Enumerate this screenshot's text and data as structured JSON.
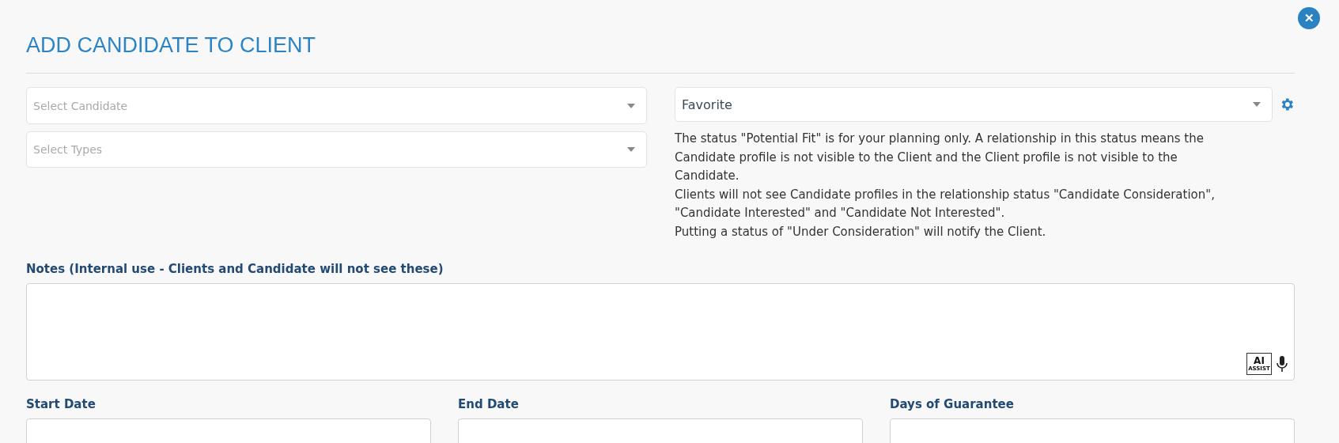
{
  "title": "ADD CANDIDATE TO CLIENT",
  "close_button": {
    "label": "✕"
  },
  "candidate_select": {
    "placeholder": "Select Candidate"
  },
  "types_select": {
    "placeholder": "Select Types"
  },
  "status_select": {
    "value": "Favorite"
  },
  "status_help": [
    "The status \"Potential Fit\" is for your planning only. A relationship in this status means the Candidate profile is not visible to the Client and the Client profile is not visible to the Candidate.",
    "Clients will not see Candidate profiles in the relationship status \"Candidate Consideration\", \"Candidate Interested\" and \"Candidate Not Interested\".",
    "Putting a status of \"Under Consideration\" will notify the Client."
  ],
  "notes": {
    "label": "Notes (Internal use - Clients and Candidate will not see these)",
    "ai_badge": {
      "top": "AI",
      "bottom": "ASSIST"
    }
  },
  "date_fields": [
    {
      "label": "Start Date"
    },
    {
      "label": "End Date"
    },
    {
      "label": "Days of Guarantee"
    }
  ]
}
